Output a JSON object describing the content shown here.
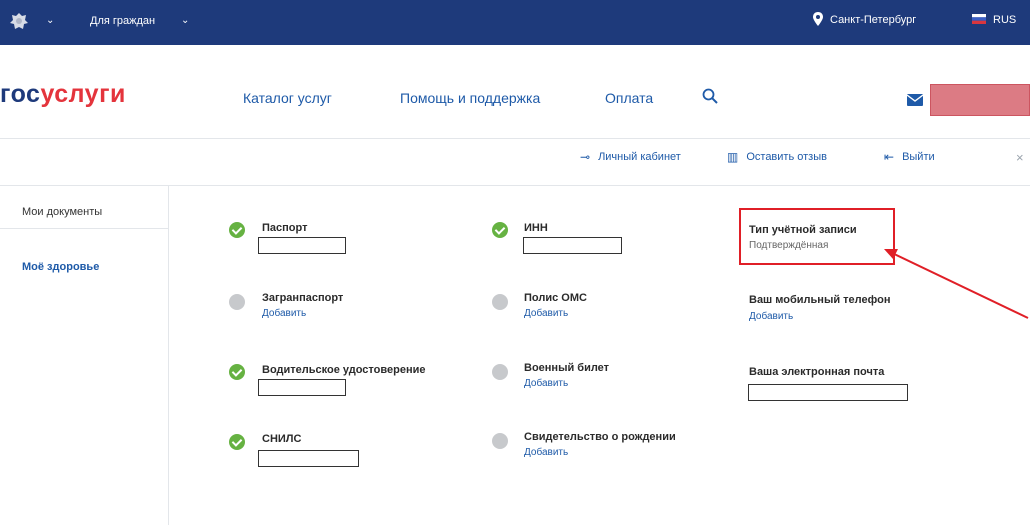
{
  "topbar": {
    "citizens_label": "Для граждан",
    "city": "Санкт-Петербург",
    "lang": "RUS",
    "chevron": "⌄"
  },
  "header": {
    "logo_part1": "гос",
    "logo_part2": "услуги",
    "nav": [
      {
        "label": "Каталог услуг"
      },
      {
        "label": "Помощь и поддержка"
      },
      {
        "label": "Оплата"
      }
    ]
  },
  "subbar": {
    "cabinet": "Личный кабинет",
    "feedback": "Оставить отзыв",
    "logout": "Выйти",
    "close": "×"
  },
  "sidebar": {
    "items": [
      {
        "label": "Мои документы"
      },
      {
        "label": "Моё здоровье"
      }
    ]
  },
  "documents": [
    {
      "title": "Паспорт",
      "status": "filled"
    },
    {
      "title": "ИНН",
      "status": "filled"
    },
    {
      "title": "Тип учётной записи",
      "value": "Подтверждённая"
    },
    {
      "title": "Загранпаспорт",
      "status": "empty",
      "action": "Добавить"
    },
    {
      "title": "Полис ОМС",
      "status": "empty",
      "action": "Добавить"
    },
    {
      "title": "Ваш мобильный телефон",
      "action": "Добавить"
    },
    {
      "title": "Водительское удостоверение",
      "status": "filled"
    },
    {
      "title": "Военный билет",
      "status": "empty",
      "action": "Добавить"
    },
    {
      "title": "Ваша электронная почта"
    },
    {
      "title": "СНИЛС",
      "status": "filled"
    },
    {
      "title": "Свидетельство о рождении",
      "status": "empty",
      "action": "Добавить"
    }
  ],
  "colors": {
    "topbar": "#1e3a7b",
    "link": "#1e5aa8",
    "logo_red": "#e4343c",
    "ok": "#66b242",
    "empty": "#c7c9cc",
    "annotation": "#e01f27"
  }
}
